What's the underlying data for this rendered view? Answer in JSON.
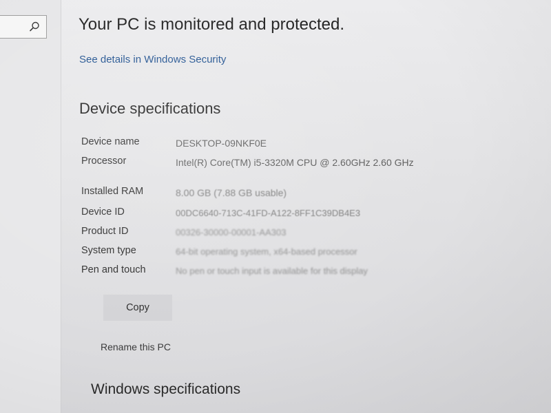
{
  "search": {
    "icon": "search-icon"
  },
  "header": {
    "status_title": "Your PC is monitored and protected.",
    "security_link": "See details in Windows Security"
  },
  "device_specs": {
    "title": "Device specifications",
    "rows": [
      {
        "label": "Device name",
        "value": "DESKTOP-09NKF0E"
      },
      {
        "label": "Processor",
        "value": "Intel(R) Core(TM) i5-3320M CPU @ 2.60GHz   2.60 GHz"
      },
      {
        "label": "Installed RAM",
        "value": "8.00 GB (7.88 GB usable)"
      },
      {
        "label": "Device ID",
        "value": "00DC6640-713C-41FD-A122-8FF1C39DB4E3"
      },
      {
        "label": "Product ID",
        "value": "00326-30000-00001-AA303"
      },
      {
        "label": "System type",
        "value": "64-bit operating system, x64-based processor"
      },
      {
        "label": "Pen and touch",
        "value": "No pen or touch input is available for this display"
      }
    ],
    "copy_label": "Copy",
    "rename_label": "Rename this PC"
  },
  "windows_specs": {
    "title": "Windows specifications"
  },
  "colors": {
    "link": "#1d4f8e",
    "background": "#e4e4e6",
    "button": "#d3d3d6"
  }
}
